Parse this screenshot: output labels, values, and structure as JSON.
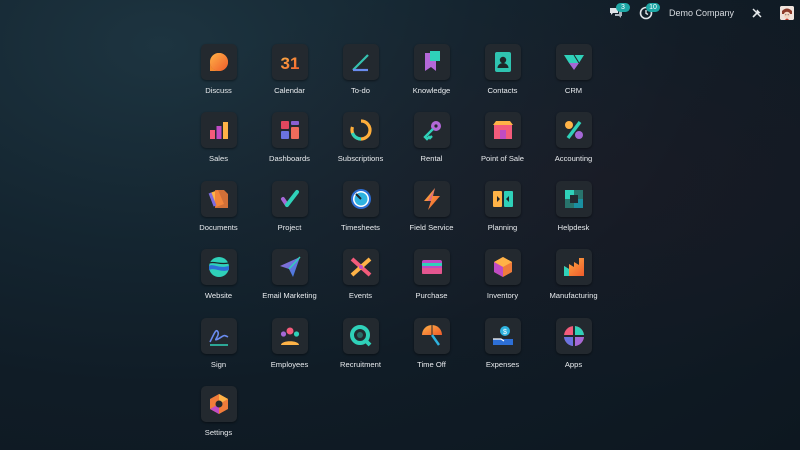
{
  "topbar": {
    "messages_badge": "3",
    "activities_badge": "10",
    "company_name": "Demo Company"
  },
  "apps": [
    {
      "label": "Discuss",
      "icon": "discuss-icon"
    },
    {
      "label": "Calendar",
      "icon": "calendar-icon",
      "icon_text": "31"
    },
    {
      "label": "To-do",
      "icon": "todo-icon"
    },
    {
      "label": "Knowledge",
      "icon": "knowledge-icon"
    },
    {
      "label": "Contacts",
      "icon": "contacts-icon"
    },
    {
      "label": "CRM",
      "icon": "crm-icon"
    },
    {
      "label": "Sales",
      "icon": "sales-icon"
    },
    {
      "label": "Dashboards",
      "icon": "dashboards-icon"
    },
    {
      "label": "Subscriptions",
      "icon": "subscriptions-icon"
    },
    {
      "label": "Rental",
      "icon": "rental-icon"
    },
    {
      "label": "Point of Sale",
      "icon": "point-of-sale-icon"
    },
    {
      "label": "Accounting",
      "icon": "accounting-icon"
    },
    {
      "label": "Documents",
      "icon": "documents-icon"
    },
    {
      "label": "Project",
      "icon": "project-icon"
    },
    {
      "label": "Timesheets",
      "icon": "timesheets-icon"
    },
    {
      "label": "Field Service",
      "icon": "field-service-icon"
    },
    {
      "label": "Planning",
      "icon": "planning-icon"
    },
    {
      "label": "Helpdesk",
      "icon": "helpdesk-icon"
    },
    {
      "label": "Website",
      "icon": "website-icon"
    },
    {
      "label": "Email Marketing",
      "icon": "email-marketing-icon"
    },
    {
      "label": "Events",
      "icon": "events-icon"
    },
    {
      "label": "Purchase",
      "icon": "purchase-icon"
    },
    {
      "label": "Inventory",
      "icon": "inventory-icon"
    },
    {
      "label": "Manufacturing",
      "icon": "manufacturing-icon"
    },
    {
      "label": "Sign",
      "icon": "sign-icon"
    },
    {
      "label": "Employees",
      "icon": "employees-icon"
    },
    {
      "label": "Recruitment",
      "icon": "recruitment-icon"
    },
    {
      "label": "Time Off",
      "icon": "time-off-icon"
    },
    {
      "label": "Expenses",
      "icon": "expenses-icon"
    },
    {
      "label": "Apps",
      "icon": "apps-icon"
    },
    {
      "label": "Settings",
      "icon": "settings-icon"
    }
  ]
}
